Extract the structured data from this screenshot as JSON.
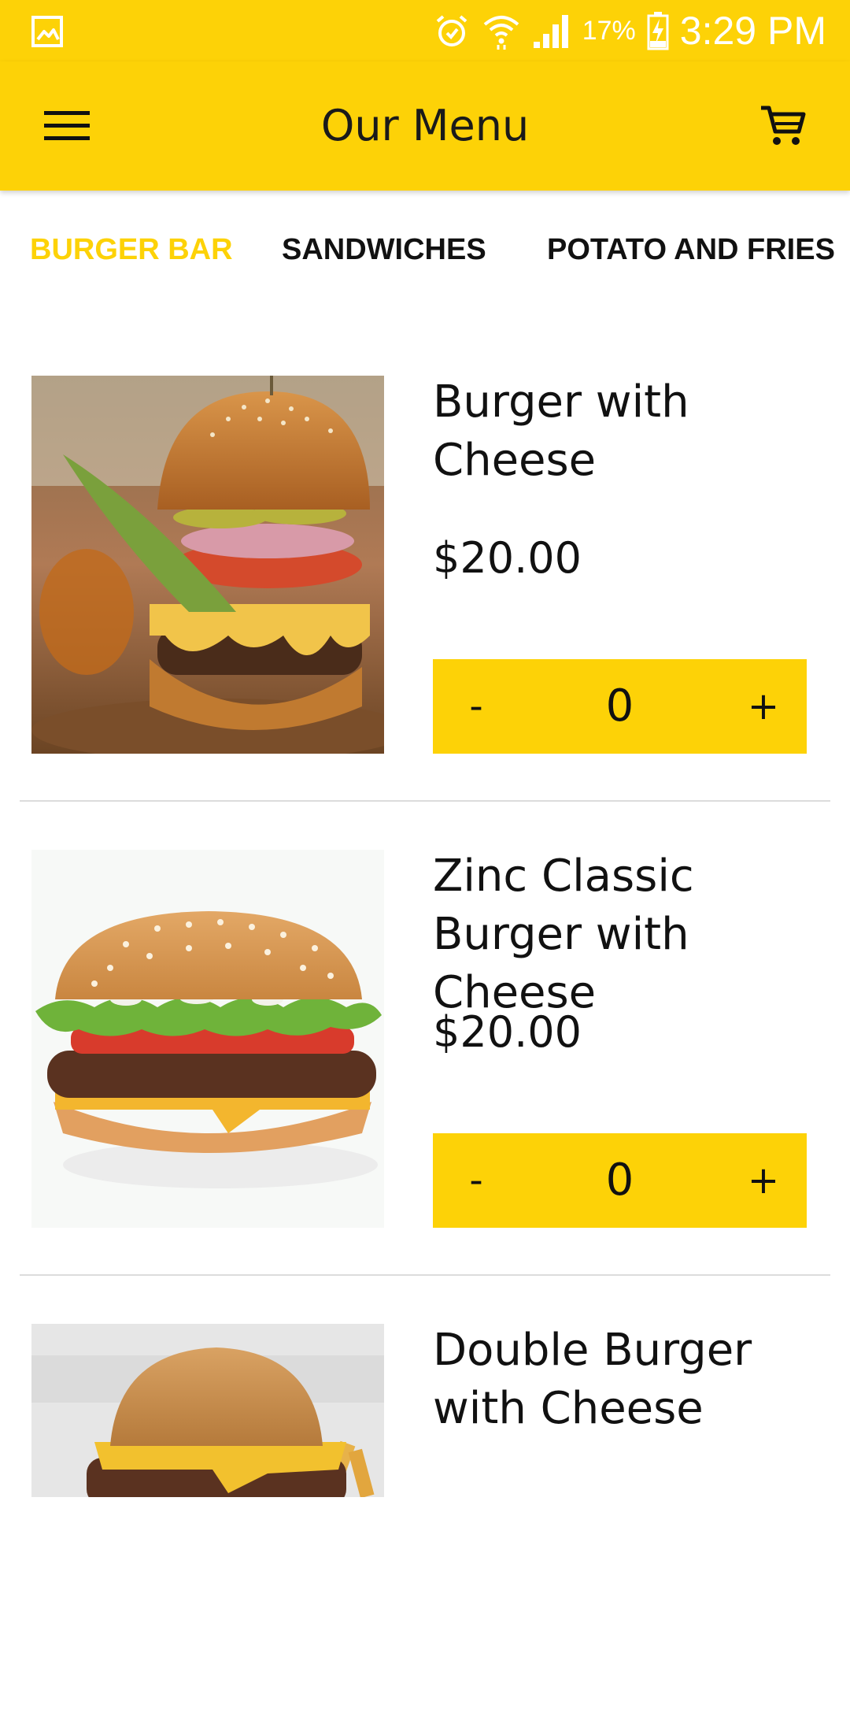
{
  "status_bar": {
    "icons": [
      "gallery-icon",
      "alarm-icon",
      "wifi-icon",
      "signal-icon",
      "battery-charging-icon"
    ],
    "battery": "17%",
    "time": "3:29 PM"
  },
  "app_bar": {
    "title": "Our Menu",
    "left_icon": "hamburger-menu-icon",
    "right_icon": "cart-icon"
  },
  "tabs": [
    {
      "label": "BURGER BAR",
      "active": true
    },
    {
      "label": "SANDWICHES",
      "active": false
    },
    {
      "label": "POTATO AND FRIES",
      "active": false
    }
  ],
  "menu_items": [
    {
      "name": "Burger with Cheese",
      "price": "$20.00",
      "quantity": "0",
      "minus": "-",
      "plus": "+"
    },
    {
      "name": "Zinc Classic Burger with Cheese",
      "price": "$20.00",
      "quantity": "0",
      "minus": "-",
      "plus": "+"
    },
    {
      "name": "Double Burger with Cheese"
    }
  ],
  "colors": {
    "accent": "#FDD207",
    "text": "#111111",
    "divider": "#DCDCDC"
  }
}
